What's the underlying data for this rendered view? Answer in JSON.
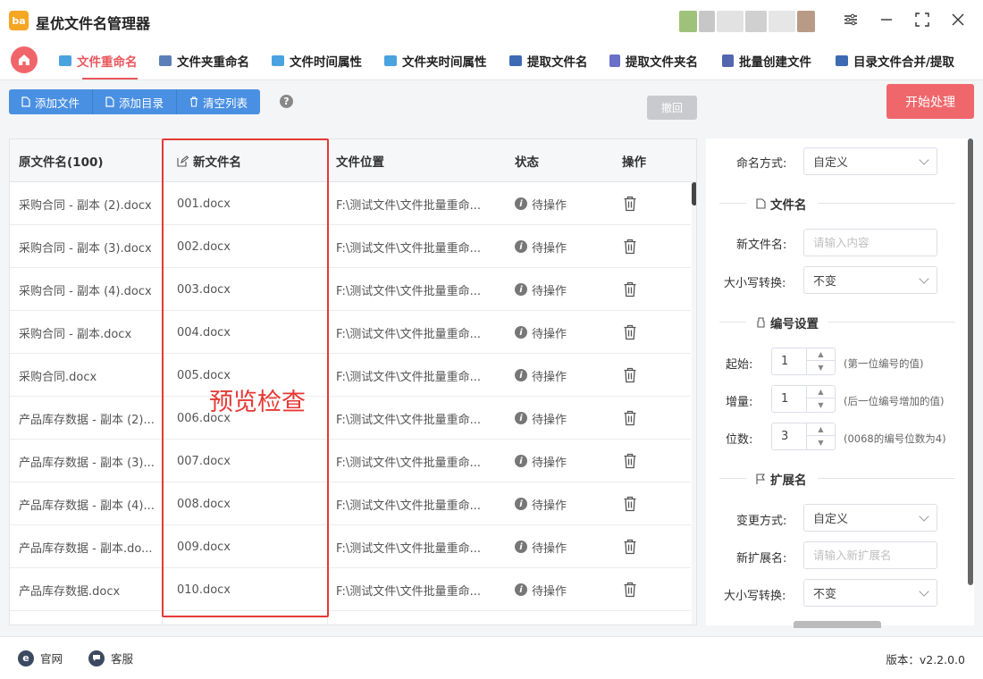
{
  "app": {
    "title": "星优文件名管理器",
    "logo_text": "ba"
  },
  "nav": {
    "tabs": [
      {
        "label": "文件重命名",
        "active": true,
        "icon_color": "#4aa3df"
      },
      {
        "label": "文件夹重命名",
        "active": false,
        "icon_color": "#5b7fb8"
      },
      {
        "label": "文件时间属性",
        "active": false,
        "icon_color": "#4aa3df"
      },
      {
        "label": "文件夹时间属性",
        "active": false,
        "icon_color": "#4aa3df"
      },
      {
        "label": "提取文件名",
        "active": false,
        "icon_color": "#3d6bb3"
      },
      {
        "label": "提取文件夹名",
        "active": false,
        "icon_color": "#6a6fc8"
      },
      {
        "label": "批量创建文件",
        "active": false,
        "icon_color": "#5466b0"
      },
      {
        "label": "目录文件合并/提取",
        "active": false,
        "icon_color": "#3d6bb3"
      }
    ]
  },
  "toolbar": {
    "add_file": "添加文件",
    "add_dir": "添加目录",
    "clear_list": "清空列表",
    "help": "?",
    "undo": "撤回",
    "start": "开始处理"
  },
  "table": {
    "headers": {
      "original": "原文件名(100)",
      "new_name": "新文件名",
      "location": "文件位置",
      "status": "状态",
      "action": "操作"
    },
    "rows": [
      {
        "original": "采购合同 - 副本 (2).docx",
        "new_name": "001.docx",
        "location": "F:\\测试文件\\文件批量重命...",
        "status": "待操作"
      },
      {
        "original": "采购合同 - 副本 (3).docx",
        "new_name": "002.docx",
        "location": "F:\\测试文件\\文件批量重命...",
        "status": "待操作"
      },
      {
        "original": "采购合同 - 副本 (4).docx",
        "new_name": "003.docx",
        "location": "F:\\测试文件\\文件批量重命...",
        "status": "待操作"
      },
      {
        "original": "采购合同 - 副本.docx",
        "new_name": "004.docx",
        "location": "F:\\测试文件\\文件批量重命...",
        "status": "待操作"
      },
      {
        "original": "采购合同.docx",
        "new_name": "005.docx",
        "location": "F:\\测试文件\\文件批量重命...",
        "status": "待操作"
      },
      {
        "original": "产品库存数据 - 副本 (2)...",
        "new_name": "006.docx",
        "location": "F:\\测试文件\\文件批量重命...",
        "status": "待操作"
      },
      {
        "original": "产品库存数据 - 副本 (3)...",
        "new_name": "007.docx",
        "location": "F:\\测试文件\\文件批量重命...",
        "status": "待操作"
      },
      {
        "original": "产品库存数据 - 副本 (4)...",
        "new_name": "008.docx",
        "location": "F:\\测试文件\\文件批量重命...",
        "status": "待操作"
      },
      {
        "original": "产品库存数据 - 副本.do...",
        "new_name": "009.docx",
        "location": "F:\\测试文件\\文件批量重命...",
        "status": "待操作"
      },
      {
        "original": "产品库存数据.docx",
        "new_name": "010.docx",
        "location": "F:\\测试文件\\文件批量重命...",
        "status": "待操作"
      }
    ]
  },
  "overlay_text": "预览检查",
  "panel": {
    "naming_mode_label": "命名方式:",
    "naming_mode_value": "自定义",
    "filename_section": "文件名",
    "new_name_label": "新文件名:",
    "new_name_placeholder": "请输入内容",
    "case_label": "大小写转换:",
    "case_value": "不变",
    "numbering_section": "编号设置",
    "start_label": "起始:",
    "start_value": "1",
    "start_hint": "(第一位编号的值)",
    "step_label": "增量:",
    "step_value": "1",
    "step_hint": "(后一位编号增加的值)",
    "digits_label": "位数:",
    "digits_value": "3",
    "digits_hint": "(0068的编号位数为4)",
    "ext_section": "扩展名",
    "ext_mode_label": "变更方式:",
    "ext_mode_value": "自定义",
    "new_ext_label": "新扩展名:",
    "new_ext_placeholder": "请输入新扩展名",
    "ext_case_label": "大小写转换:",
    "ext_case_value": "不变"
  },
  "footer": {
    "website": "官网",
    "support": "客服",
    "version": "版本：v2.2.0.0"
  },
  "colors": {
    "accent": "#e9575c",
    "primary_button": "#4a90e2",
    "highlight_box": "#e53935"
  }
}
